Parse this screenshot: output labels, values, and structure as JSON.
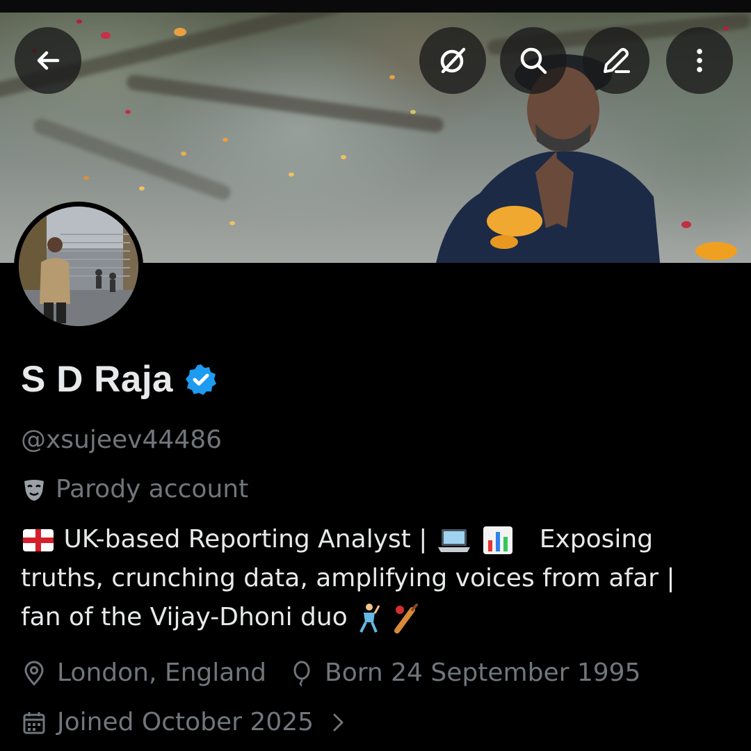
{
  "profile": {
    "display_name": "S D Raja",
    "handle": "@xsujeev44486",
    "parody_label": "Parody account",
    "bio": {
      "segment1": "UK-based Reporting Analyst |",
      "segment2": "Exposing",
      "line2": "truths, crunching data, amplifying voices from afar |",
      "line3": "fan of the Vijay-Dhoni duo"
    },
    "location": "London, England",
    "birthday": "Born 24 September 1995",
    "joined": "Joined October 2025"
  },
  "icons": {
    "back": "arrow-left-icon",
    "grok": "grok-icon",
    "search": "search-icon",
    "edit": "edit-icon",
    "more": "more-vertical-icon",
    "verified": "verified-badge-icon",
    "parody": "mask-icon",
    "location": "location-pin-icon",
    "birthday": "balloon-icon",
    "calendar": "calendar-icon",
    "chevron": "chevron-right-icon"
  },
  "colors": {
    "background": "#000000",
    "primary_text": "#e7e9ea",
    "secondary_text": "#71767b",
    "verified_blue": "#1d9bf0"
  }
}
